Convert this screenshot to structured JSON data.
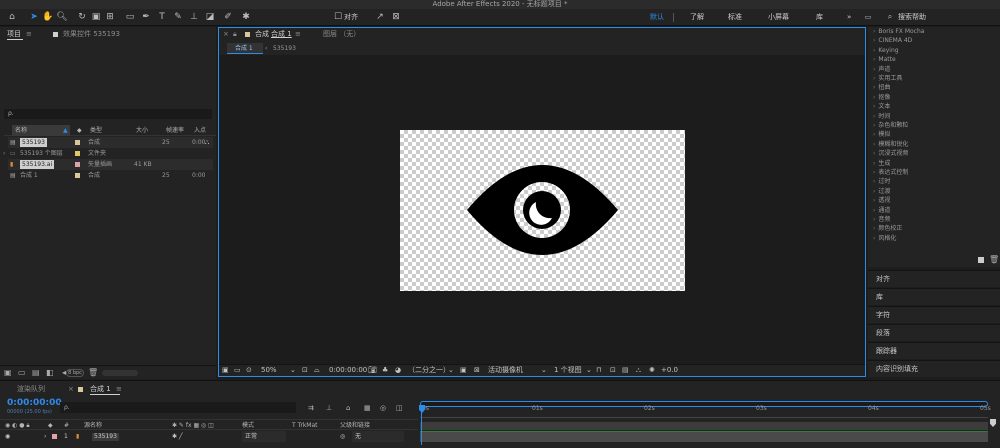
{
  "window": {
    "title": "Adobe After Effects 2020 - 无标题项目 *"
  },
  "toolbar": {
    "align_label": "对齐",
    "workspaces": [
      "默认",
      "了解",
      "标准",
      "小屏幕",
      "库"
    ],
    "more": "»",
    "search_placeholder": "搜索帮助"
  },
  "project_panel": {
    "tab": "项目",
    "menu": "≡",
    "effects_tab": "效果控件 535193",
    "search_icon_label": "ρ.",
    "columns": [
      "名称",
      "类型",
      "大小",
      "帧速率",
      "入点"
    ],
    "items": [
      {
        "name": "535193",
        "type": "合成",
        "size": "",
        "fps": "25",
        "in": "0:00",
        "color": "#d8c89a",
        "selected": true
      },
      {
        "name": "535193 个图层",
        "type": "文件夹",
        "size": "",
        "fps": "",
        "in": "",
        "color": "#e0c868",
        "selected": false
      },
      {
        "name": "535193.ai",
        "type": "矢量插画",
        "size": "41 KB",
        "fps": "",
        "in": "",
        "color": "#e4a0a8",
        "selected": true
      },
      {
        "name": "合成 1",
        "type": "合成",
        "size": "",
        "fps": "25",
        "in": "0:00",
        "color": "#d8c89a",
        "selected": false
      }
    ],
    "bpc": "8 bpc"
  },
  "viewer": {
    "tab": "合成",
    "tab_name": "合成 1",
    "menu": "≡",
    "layer_tab": "图层 （无）",
    "breadcrumb": [
      "合成 1",
      "535193"
    ],
    "zoom": "50%",
    "timecode": "0:00:00:00",
    "resolution": "（二分之一）",
    "camera": "活动摄像机",
    "views": "1 个视图",
    "exposure": "+0.0"
  },
  "effects_panel": {
    "items": [
      "Boris FX Mocha",
      "CINEMA 4D",
      "Keying",
      "Matte",
      "声道",
      "实用工具",
      "扭曲",
      "抠像",
      "文本",
      "时间",
      "杂色和颗粒",
      "模拟",
      "模糊和锐化",
      "沉浸式视频",
      "生成",
      "表达式控制",
      "过时",
      "过渡",
      "透视",
      "通道",
      "音频",
      "颜色校正",
      "风格化"
    ],
    "panels": [
      "对齐",
      "库",
      "字符",
      "段落",
      "跟踪器",
      "内容识别填充"
    ]
  },
  "timeline": {
    "render_tab": "渲染队列",
    "comp_tab": "合成 1",
    "menu": "≡",
    "timecode": "0:00:00:00",
    "timecode_sub": "00000 (25.00 fps)",
    "columns": {
      "source": "源名称",
      "mode": "模式",
      "trkmat": "T TrkMat",
      "parent": "父级和链接",
      "hash": "#"
    },
    "layer": {
      "index": "1",
      "name": "535193",
      "mode": "正常",
      "parent": "无"
    },
    "ticks": [
      "0s",
      "01s",
      "02s",
      "03s",
      "04s",
      "05s"
    ]
  },
  "colors": {
    "accent": "#2d8ceb",
    "bg": "#1d1d1d",
    "panel": "#232323"
  }
}
